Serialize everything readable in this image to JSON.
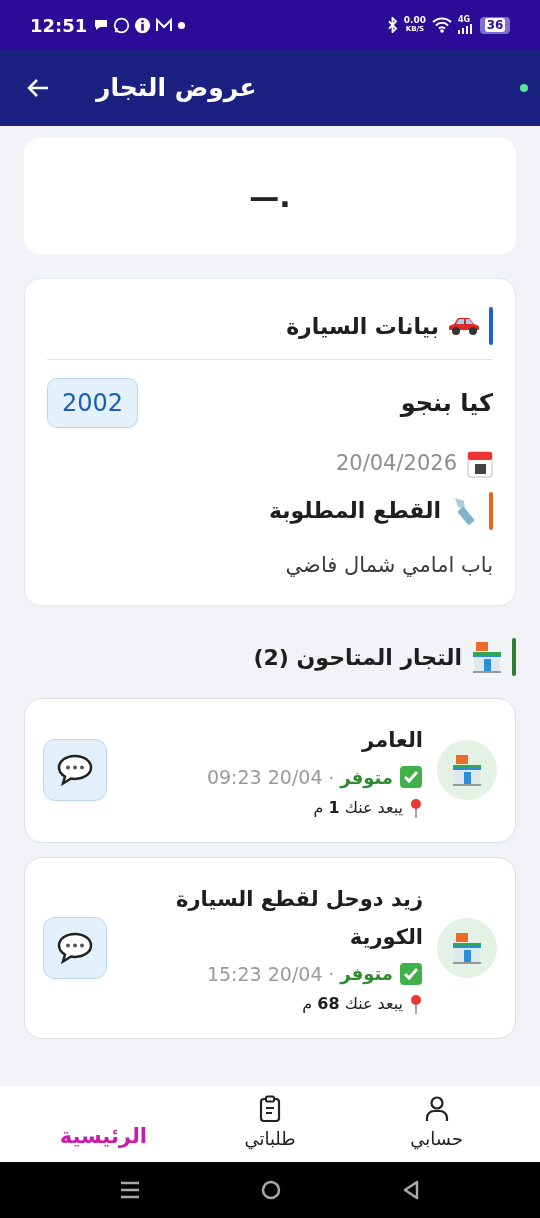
{
  "status_bar": {
    "time": "12:51",
    "net_speed": "0.00",
    "net_unit": "KB/S",
    "network": "4G",
    "battery": "36"
  },
  "app_bar": {
    "title": "عروض التجار",
    "online": true
  },
  "banner": {
    "text": "—."
  },
  "car_card": {
    "title": "بيانات السيارة",
    "model": "كيا بنجو",
    "year": "2002",
    "date": "20/04/2026",
    "parts_title": "القطع المطلوبة",
    "parts": "باب امامي شمال فاضي"
  },
  "merchants": {
    "title": "التجار المتاحون (2)",
    "items": [
      {
        "name": "العامر",
        "available": true,
        "status": "متوفر",
        "separator": "·",
        "time": "09:23 20/04",
        "distance": "يبعد عنك **1** م"
      },
      {
        "name": "زيد دوحل لقطع السيارة الكورية",
        "available": true,
        "status": "متوفر",
        "separator": "·",
        "time": "15:23 20/04",
        "distance": "يبعد عنك **68** م"
      }
    ]
  },
  "bottom_nav": [
    {
      "label": "حسابي",
      "kind": "account",
      "selected": false
    },
    {
      "label": "طلباتي",
      "kind": "orders",
      "selected": false
    },
    {
      "label": "الرئيسية",
      "selected": true
    }
  ]
}
